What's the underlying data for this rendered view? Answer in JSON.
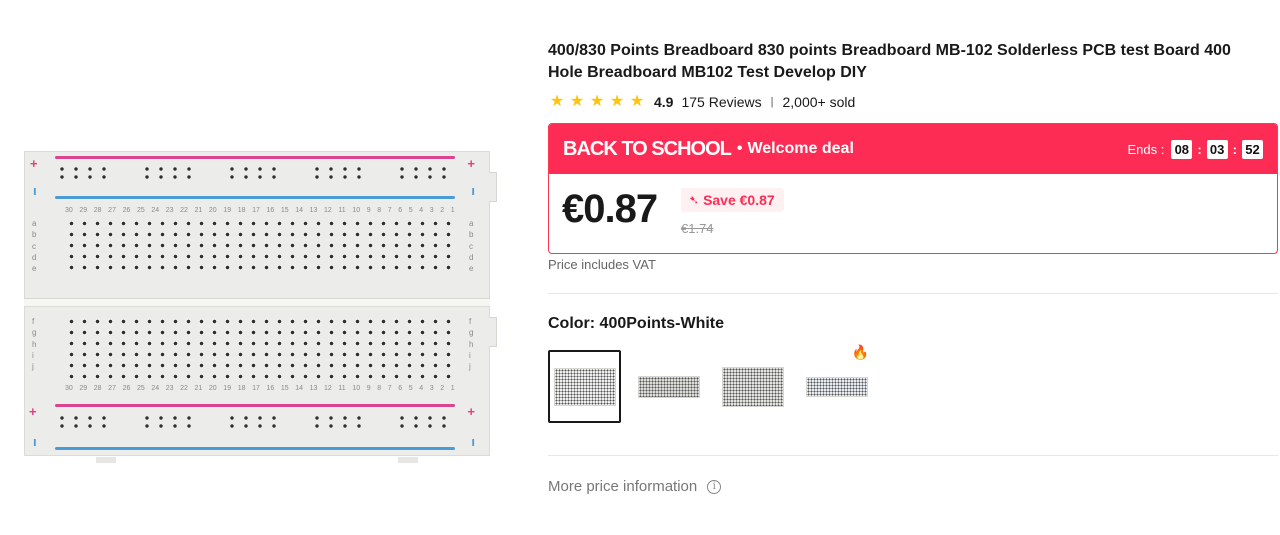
{
  "product": {
    "title": "400/830 Points Breadboard 830 points Breadboard MB-102 Solderless PCB test Board 400 Hole Breadboard MB102 Test Develop DIY",
    "rating": "4.9",
    "star_count": 5,
    "reviews": "175 Reviews",
    "separator": "|",
    "sold": "2,000+ sold",
    "image_icon": "breadboard-image"
  },
  "deal": {
    "brand": "BACK TO SCHOOL",
    "dot": "•",
    "label": "Welcome deal",
    "ends_label": "Ends :",
    "hours": "08",
    "minutes": "03",
    "seconds": "52",
    "colon": ":",
    "accent_color": "#fd2c54"
  },
  "price": {
    "current": "€0.87",
    "save": "Save €0.87",
    "save_icon": "down-arrow-icon",
    "original": "€1.74",
    "vat_note": "Price includes VAT"
  },
  "color": {
    "label": "Color: 400Points-White",
    "options": [
      {
        "name": "400Points-White",
        "selected": true,
        "hot": false
      },
      {
        "name": "option-2",
        "selected": false,
        "hot": false
      },
      {
        "name": "option-3",
        "selected": false,
        "hot": false
      },
      {
        "name": "option-4",
        "selected": false,
        "hot": true
      }
    ]
  },
  "more_price": {
    "label": "More price information",
    "icon": "info-icon"
  }
}
